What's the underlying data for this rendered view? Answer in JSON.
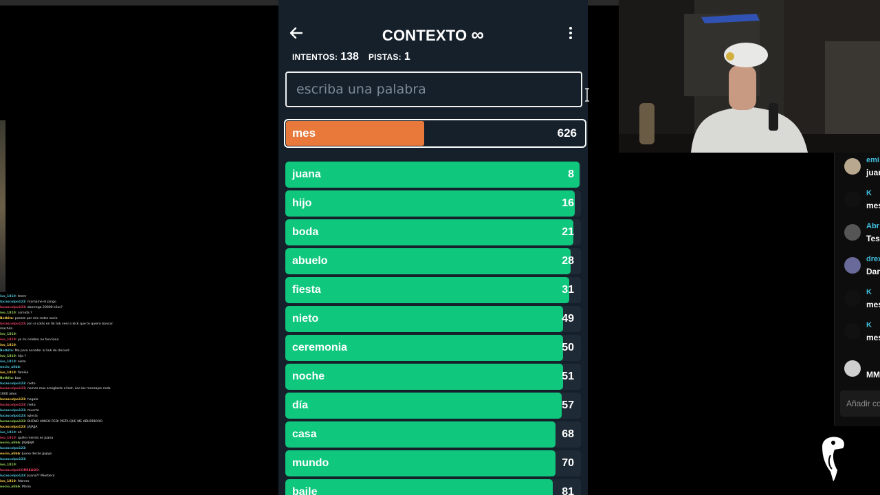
{
  "game": {
    "title": "CONTEXTO",
    "title_symbol": "∞",
    "back_icon": "arrow-left-icon",
    "menu_icon": "vertical-dots-icon",
    "stats": {
      "attempts_label": "INTENTOS:",
      "attempts_value": "138",
      "hints_label": "PISTAS:",
      "hints_value": "1"
    },
    "input_placeholder": "escriba una palabra",
    "current_guess": {
      "word": "mes",
      "rank": "626",
      "fill_fraction": 0.46
    },
    "guesses": [
      {
        "word": "juana",
        "rank": "8",
        "fill_fraction": 0.995
      },
      {
        "word": "hijo",
        "rank": "16",
        "fill_fraction": 0.98
      },
      {
        "word": "boda",
        "rank": "21",
        "fill_fraction": 0.975
      },
      {
        "word": "abuelo",
        "rank": "28",
        "fill_fraction": 0.965
      },
      {
        "word": "fiesta",
        "rank": "31",
        "fill_fraction": 0.96
      },
      {
        "word": "nieto",
        "rank": "49",
        "fill_fraction": 0.94
      },
      {
        "word": "ceremonia",
        "rank": "50",
        "fill_fraction": 0.94
      },
      {
        "word": "noche",
        "rank": "51",
        "fill_fraction": 0.94
      },
      {
        "word": "día",
        "rank": "57",
        "fill_fraction": 0.935
      },
      {
        "word": "casa",
        "rank": "68",
        "fill_fraction": 0.915
      },
      {
        "word": "mundo",
        "rank": "70",
        "fill_fraction": 0.915
      },
      {
        "word": "baile",
        "rank": "81",
        "fill_fraction": 0.905
      }
    ],
    "colors": {
      "background": "#15202b",
      "close": "#10c77e",
      "medium": "#e9793a",
      "border": "#ffffff"
    }
  },
  "left_chat": [
    {
      "user": "ivo_1810",
      "text": ": tmmr"
    },
    {
      "user": "lucascolpo123",
      "text": ": mamame el pingo"
    },
    {
      "user": "lucascolpo123",
      "text": ": aborrega 20000 kilos?"
    },
    {
      "user": "ivo_1810",
      "text": ": comida ?"
    },
    {
      "user": "Botkita",
      "text": ": pasate por mis redes socio"
    },
    {
      "user": "lucascolpo123",
      "text": ": Jon si colás en tik tok vení a kick que te quiero bancar"
    },
    {
      "user": "",
      "text": "mochila"
    },
    {
      "user": "ivo_1810",
      "text": ":"
    },
    {
      "user": "ivo_1810",
      "text": ": yo mi celebro no funciona"
    },
    {
      "user": "ivo_1810",
      "text": ":"
    },
    {
      "user": "Botkita",
      "text": ": Ma para acceder al link de discord"
    },
    {
      "user": "ivo_1810",
      "text": ": hijo ?"
    },
    {
      "user": "ivo_1810",
      "text": ": nieto"
    },
    {
      "user": "nocio_alibb",
      "text": ":"
    },
    {
      "user": "ivo_1810",
      "text": ": familia"
    },
    {
      "user": "Botkita",
      "text": ": boo"
    },
    {
      "user": "lucascolpo123",
      "text": ": nieto"
    },
    {
      "user": "lucascolpo123",
      "text": ": nomos mas arreglaste el bot, Leo los mensajes cada"
    },
    {
      "user": "",
      "text": "1000 años"
    },
    {
      "user": "lucascolpo123",
      "text": ": hogalo"
    },
    {
      "user": "lucascolpo123",
      "text": ": nieto"
    },
    {
      "user": "lucascolpo123",
      "text": ": muerte"
    },
    {
      "user": "lucascolpo123",
      "text": ": iglesia"
    },
    {
      "user": "lucascolpo123",
      "text": ": BUENO AMIGO PEDI PISTA QUE ME ABURRIOOO"
    },
    {
      "user": "lucascolpo123",
      "text": ": JAJAJJA"
    },
    {
      "user": "ivo_1810",
      "text": ": ah"
    },
    {
      "user": "ivo_1810",
      "text": ": quién mierda es Juana"
    },
    {
      "user": "nocio_alibb",
      "text": ": JAJAJAJA"
    },
    {
      "user": "lucascolpo123",
      "text": ":"
    },
    {
      "user": "nocio_alibb",
      "text": ": Juana decile Jjajaja"
    },
    {
      "user": "lucascolpo123",
      "text": ":"
    },
    {
      "user": "ivo_1810",
      "text": ":"
    },
    {
      "user": "lucascolpoCORREADO",
      "text": ":"
    },
    {
      "user": "lucascolpo123",
      "text": ": Juana?? Mierbera"
    },
    {
      "user": "ivo_1810",
      "text": ": febrero"
    },
    {
      "user": "nocio_alibb",
      "text": ": Maria"
    }
  ],
  "right_chat": {
    "messages": [
      {
        "name": "emi",
        "text": "juan",
        "avatar_color": "#b8a890"
      },
      {
        "name": "K",
        "text": "mes",
        "avatar_color": "#111111"
      },
      {
        "name": "Abr",
        "text": "Tes",
        "avatar_color": "#555555"
      },
      {
        "name": "drex",
        "text": "Dar",
        "avatar_color": "#6a6a9a"
      },
      {
        "name": "K",
        "text": "mes",
        "avatar_color": "#111111"
      },
      {
        "name": "K",
        "text": "mes",
        "avatar_color": "#111111"
      },
      {
        "name": "",
        "text": "MM",
        "avatar_color": "#cfcfcf"
      }
    ],
    "input_placeholder": "Añadir co"
  },
  "logo_icon": "toucan-logo-icon",
  "webcam_label": "webcam-feed"
}
